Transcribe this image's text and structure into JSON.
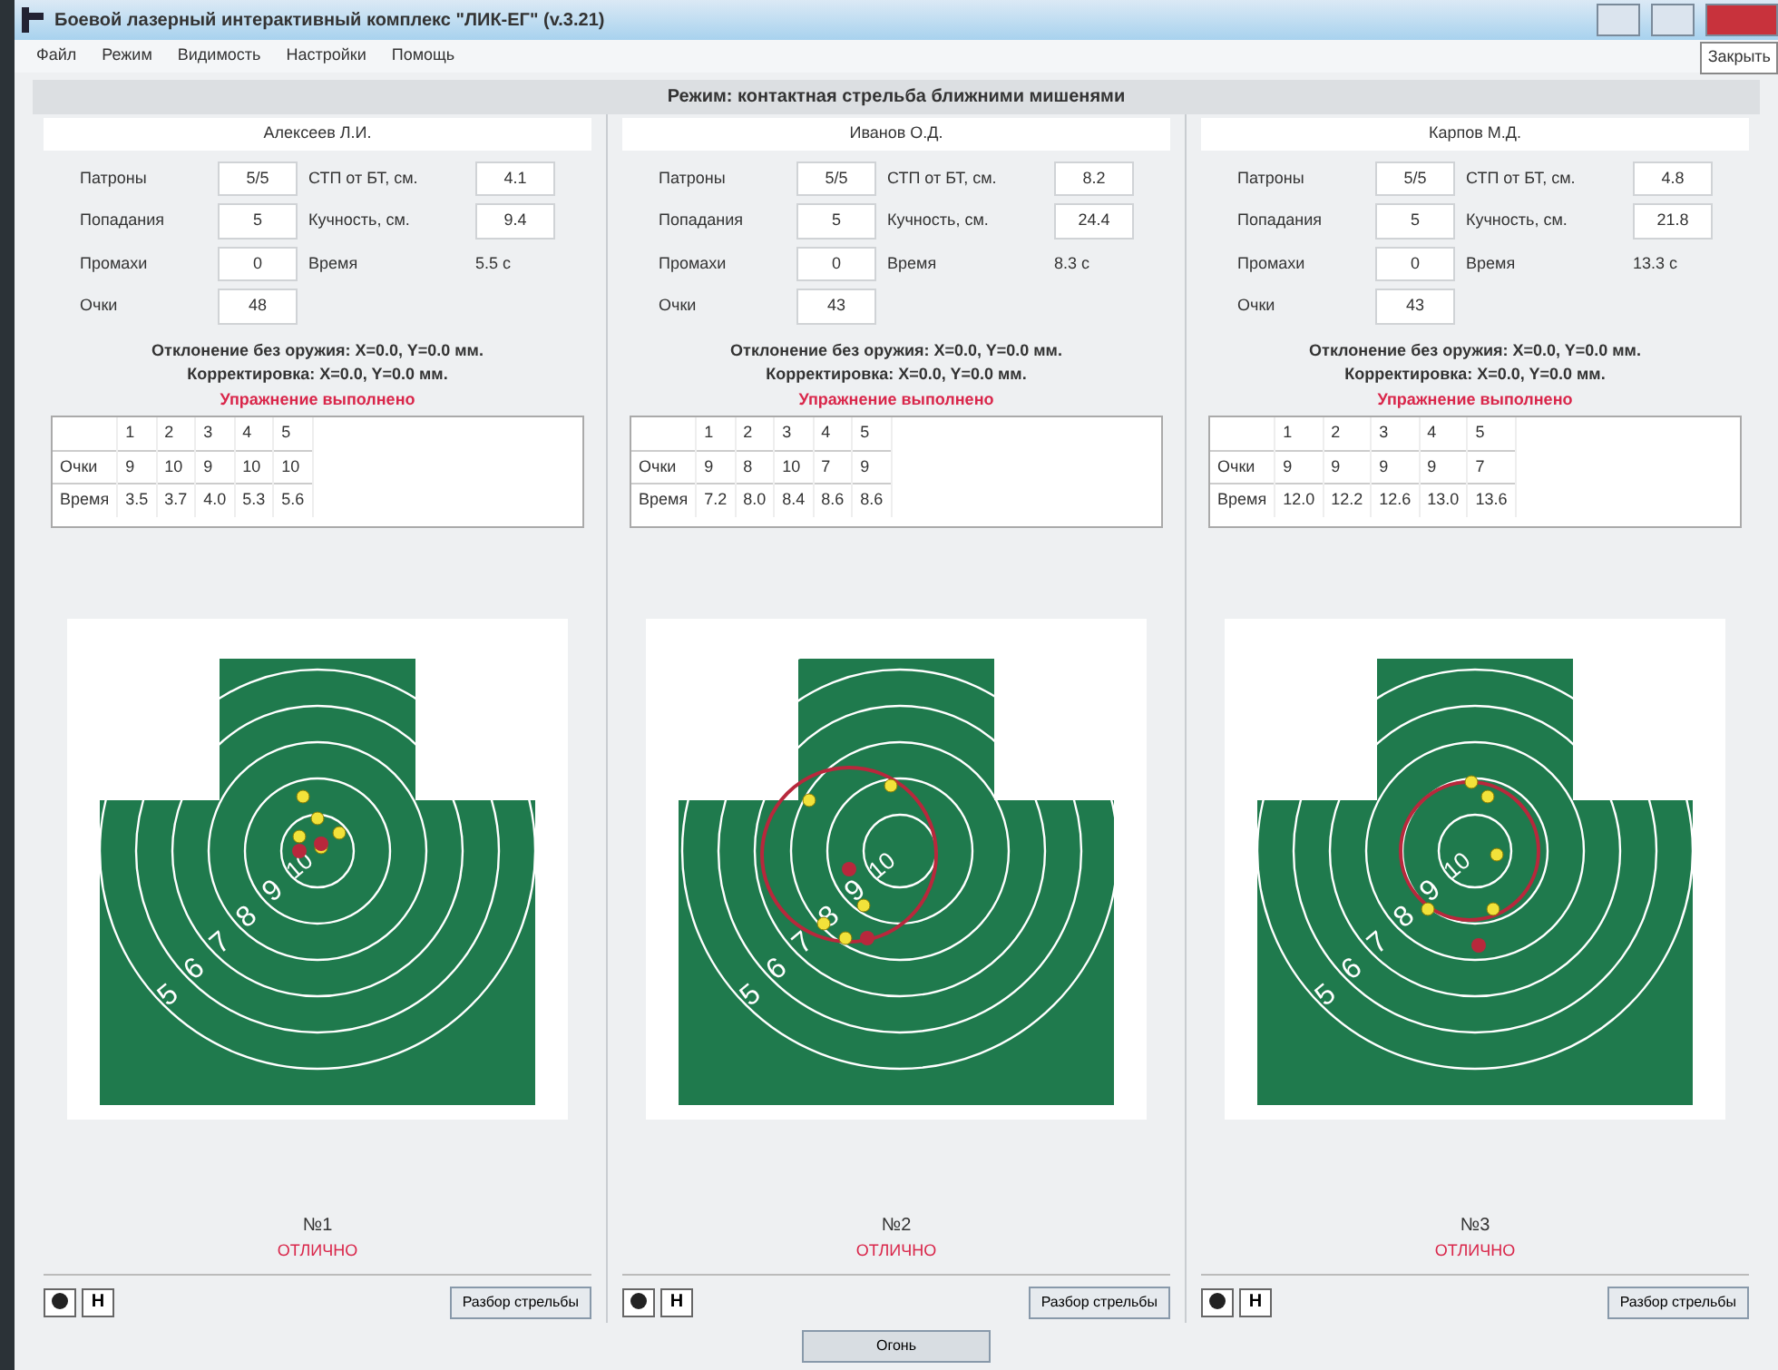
{
  "window": {
    "title": "Боевой лазерный интерактивный комплекс \"ЛИК-ЕГ\" (v.3.21)",
    "close_tooltip": "Закрыть"
  },
  "menu": [
    "Файл",
    "Режим",
    "Видимость",
    "Настройки",
    "Помощь"
  ],
  "mode_header": "Режим: контактная стрельба ближними мишенями",
  "panels": [
    {
      "name": "Алексеев Л.И.",
      "stats_left": [
        {
          "label": "Патроны",
          "value": "5/5"
        },
        {
          "label": "Попадания",
          "value": "5"
        },
        {
          "label": "Промахи",
          "value": "0"
        },
        {
          "label": "Очки",
          "value": "48"
        }
      ],
      "stats_right": [
        {
          "label": "СТП от БТ, см.",
          "value": "4.1",
          "kind": "field"
        },
        {
          "label": "Кучность, см.",
          "value": "9.4",
          "kind": "field"
        },
        {
          "label": "Время",
          "value": "5.5 с",
          "kind": "text"
        }
      ],
      "deviation": "Отклонение без оружия: X=0.0, Y=0.0 мм.",
      "correction": "Корректировка: X=0.0, Y=0.0 мм.",
      "status": "Упражнение выполнено",
      "table": {
        "columns": [
          "1",
          "2",
          "3",
          "4",
          "5"
        ],
        "rows": [
          {
            "label": "Очки",
            "cells": [
              "9",
              "10",
              "9",
              "10",
              "10"
            ]
          },
          {
            "label": "Время",
            "cells": [
              "3.5",
              "3.7",
              "4.0",
              "5.3",
              "5.6"
            ]
          }
        ]
      },
      "ring_labels": [
        "5",
        "6",
        "7",
        "8",
        "9",
        "10"
      ],
      "number": "№1",
      "grade": "ОТЛИЧНО",
      "h_button": "H",
      "review_button": "Разбор стрельбы"
    },
    {
      "name": "Иванов О.Д.",
      "stats_left": [
        {
          "label": "Патроны",
          "value": "5/5"
        },
        {
          "label": "Попадания",
          "value": "5"
        },
        {
          "label": "Промахи",
          "value": "0"
        },
        {
          "label": "Очки",
          "value": "43"
        }
      ],
      "stats_right": [
        {
          "label": "СТП от БТ, см.",
          "value": "8.2",
          "kind": "field"
        },
        {
          "label": "Кучность, см.",
          "value": "24.4",
          "kind": "field"
        },
        {
          "label": "Время",
          "value": "8.3 с",
          "kind": "text"
        }
      ],
      "deviation": "Отклонение без оружия: X=0.0, Y=0.0 мм.",
      "correction": "Корректировка: X=0.0, Y=0.0 мм.",
      "status": "Упражнение выполнено",
      "table": {
        "columns": [
          "1",
          "2",
          "3",
          "4",
          "5"
        ],
        "rows": [
          {
            "label": "Очки",
            "cells": [
              "9",
              "8",
              "10",
              "7",
              "9"
            ]
          },
          {
            "label": "Время",
            "cells": [
              "7.2",
              "8.0",
              "8.4",
              "8.6",
              "8.6"
            ]
          }
        ]
      },
      "ring_labels": [
        "5",
        "6",
        "7",
        "8",
        "9",
        "10"
      ],
      "number": "№2",
      "grade": "ОТЛИЧНО",
      "h_button": "H",
      "review_button": "Разбор стрельбы"
    },
    {
      "name": "Карпов М.Д.",
      "stats_left": [
        {
          "label": "Патроны",
          "value": "5/5"
        },
        {
          "label": "Попадания",
          "value": "5"
        },
        {
          "label": "Промахи",
          "value": "0"
        },
        {
          "label": "Очки",
          "value": "43"
        }
      ],
      "stats_right": [
        {
          "label": "СТП от БТ, см.",
          "value": "4.8",
          "kind": "field"
        },
        {
          "label": "Кучность, см.",
          "value": "21.8",
          "kind": "field"
        },
        {
          "label": "Время",
          "value": "13.3 с",
          "kind": "text"
        }
      ],
      "deviation": "Отклонение без оружия: X=0.0, Y=0.0 мм.",
      "correction": "Корректировка: X=0.0, Y=0.0 мм.",
      "status": "Упражнение выполнено",
      "table": {
        "columns": [
          "1",
          "2",
          "3",
          "4",
          "5"
        ],
        "rows": [
          {
            "label": "Очки",
            "cells": [
              "9",
              "9",
              "9",
              "9",
              "7"
            ]
          },
          {
            "label": "Время",
            "cells": [
              "12.0",
              "12.2",
              "12.6",
              "13.0",
              "13.6"
            ]
          }
        ]
      },
      "ring_labels": [
        "5",
        "6",
        "7",
        "8",
        "9",
        "10"
      ],
      "number": "№3",
      "grade": "ОТЛИЧНО",
      "h_button": "H",
      "review_button": "Разбор стрельбы"
    }
  ],
  "fire_button": "Огонь"
}
